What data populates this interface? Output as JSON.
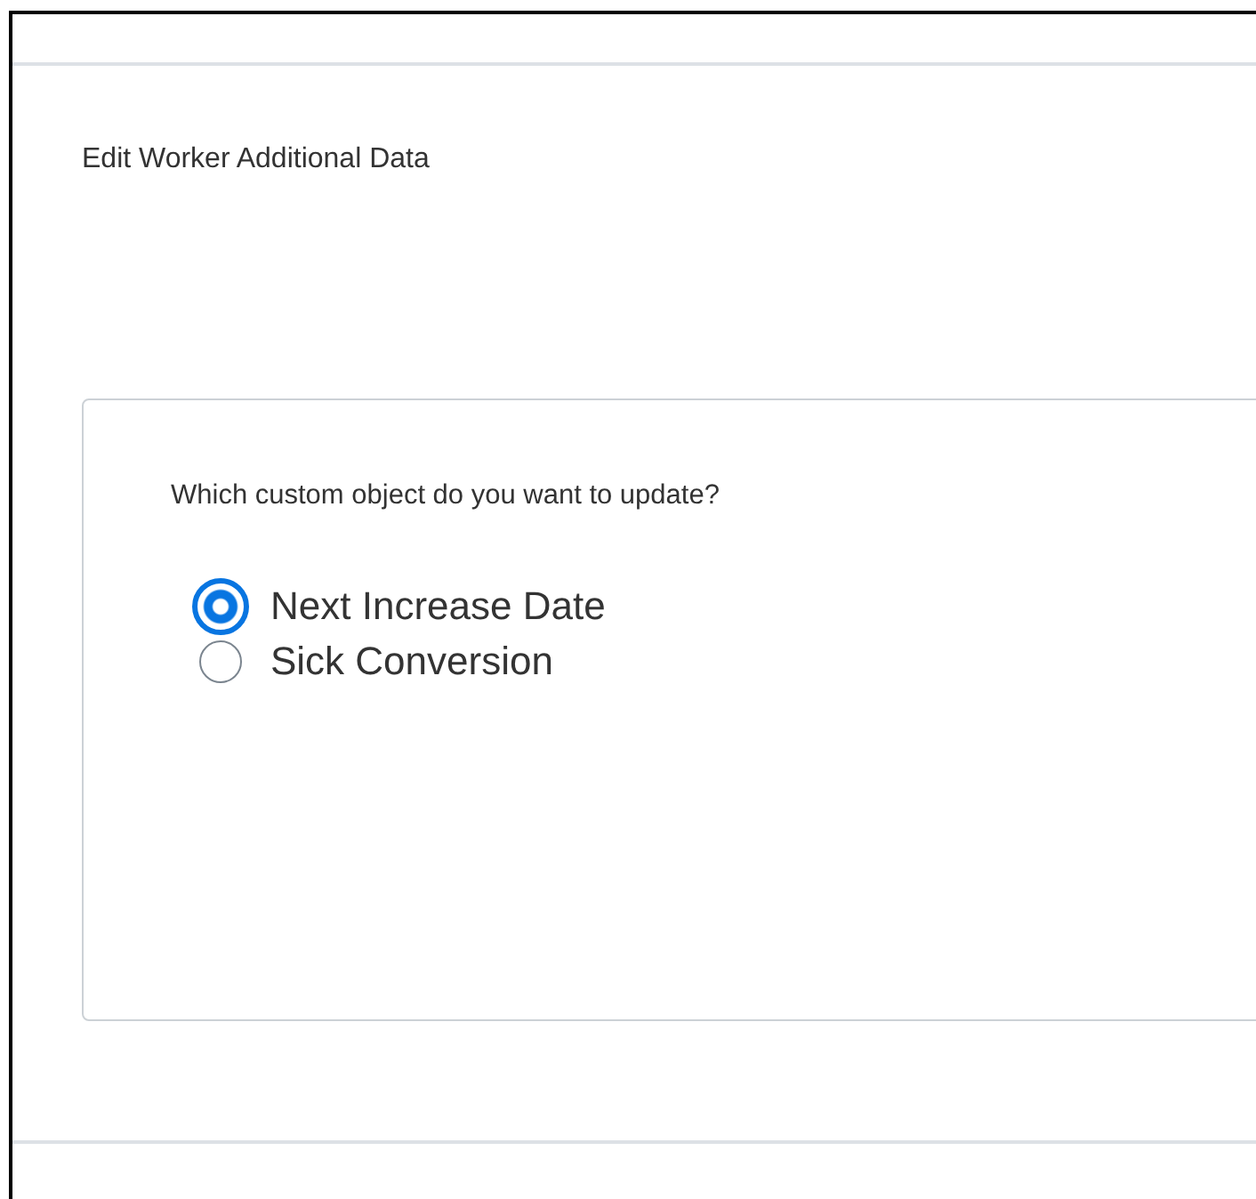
{
  "page": {
    "title": "Edit Worker Additional Data"
  },
  "question": {
    "prompt": "Which custom object do you want to update?",
    "options": [
      {
        "label": "Next Increase Date",
        "selected": true
      },
      {
        "label": "Sick Conversion",
        "selected": false
      }
    ]
  }
}
